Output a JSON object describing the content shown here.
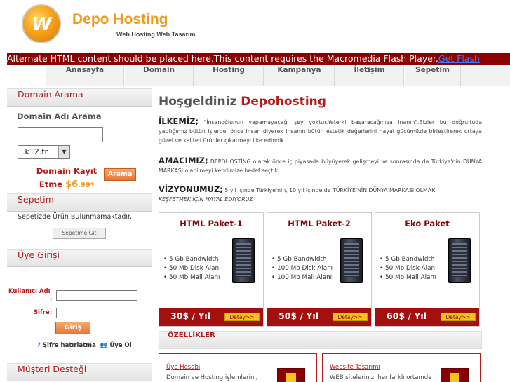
{
  "header": {
    "logo_letter": "W",
    "brand": "Depo Hosting",
    "tagline": "Web Hosting Web Tasarım"
  },
  "flash_bar": {
    "text": "Alternate HTML content should be placed here.This content requires the Macromedia Flash Player.",
    "link": "Get Flash"
  },
  "nav": {
    "items": [
      {
        "label": "Anasayfa"
      },
      {
        "label": "Domain"
      },
      {
        "label": "Hosting"
      },
      {
        "label": "Kampanya"
      },
      {
        "label": "İletişim"
      },
      {
        "label": "Sepetim"
      }
    ]
  },
  "sidebar": {
    "domain": {
      "heading": "Domain Arama",
      "subheading": "Domain Adı Arama",
      "input_value": "",
      "tld_selected": ".k12.tr",
      "promo_line1": "Domain Kayıt",
      "promo_line2": "Etme",
      "promo_price": "$6",
      "promo_cents": ".99*",
      "search_button": "Arama"
    },
    "cart": {
      "heading": "Sepetim",
      "message": "Sepetizde Ürün Bulunmamaktadır.",
      "button": "Sepetime Git"
    },
    "login": {
      "heading": "Üye Girişi",
      "username_label": "Kullanıcı Adı",
      "username_colon": ":",
      "password_label": "Şifre:",
      "button": "Giriş",
      "forgot_link": "Şifre hatırlatma",
      "register_link": "Üye Ol"
    },
    "support": {
      "heading": "Müşteri Desteği"
    }
  },
  "main": {
    "welcome_prefix": "Hoşgeldiniz",
    "welcome_brand": "Depohosting",
    "ilkemiz_label": "İLKEMİZ;",
    "ilkemiz_text": " \"İnsanoğlunun yapamayacağı şey yoktur.Yeterki başaracağınıza inanın\".Bizler bu doğrultuda yaptığımız bütün işlerde, önce insan diyerek insanın bütün estetik değerlerini hayal gücümüzle birleştirerek ortaya güzel ve kaliteli ürünler çıkarmayı ilke edindik.",
    "amacimiz_label": "AMACIMIZ;",
    "amacimiz_text": " DEPOHOSTİNG olarak önce iç piyasada büyüyerek gelişmeyi ve sonrasında da Türkiye'nin DÜNYA MARKASI olabilmeyi kendimize hedef seçtik.",
    "vizyon_label": "VİZYONUMUZ;",
    "vizyon_text": " 5 yıl içinde Türkiye'nin, 10 yıl içinde de TÜRKİYE'NİN DÜNYA MARKASI OLMAK.",
    "vizyon_italic": "KEŞFETMEK İÇİN HAYAL EDİYORUZ",
    "packages": [
      {
        "title": "HTML Paket-1",
        "features": [
          "5 Gb Bandwidth",
          "50 Mb Disk Alanı",
          "50 Mb Mail Alanı"
        ],
        "price": "30$ / Yıl",
        "detail": "Detay>>"
      },
      {
        "title": "HTML Paket-2",
        "features": [
          "5 Gb Bandwidth",
          "100 Mb Disk Alanı",
          "100 Mb Mail Alanı"
        ],
        "price": "50$ / Yıl",
        "detail": "Detay>>"
      },
      {
        "title": "Eko Paket",
        "features": [
          "5 Gb Bandwidth",
          "50 Mb Disk Alanı",
          "50 Mb Mail Alanı"
        ],
        "price": "60$ / Yıl",
        "detail": "Detay>>"
      }
    ],
    "features_heading": "ÖZELLİKLER",
    "feature_boxes": [
      {
        "title": "Üye Hesabı",
        "desc": "Domain ve Hosting işlemlerini,"
      },
      {
        "title": "Website Tasarımı",
        "desc": "WEB sitelerinizi her farklı ortamda sergiyor isleyecek"
      }
    ]
  }
}
